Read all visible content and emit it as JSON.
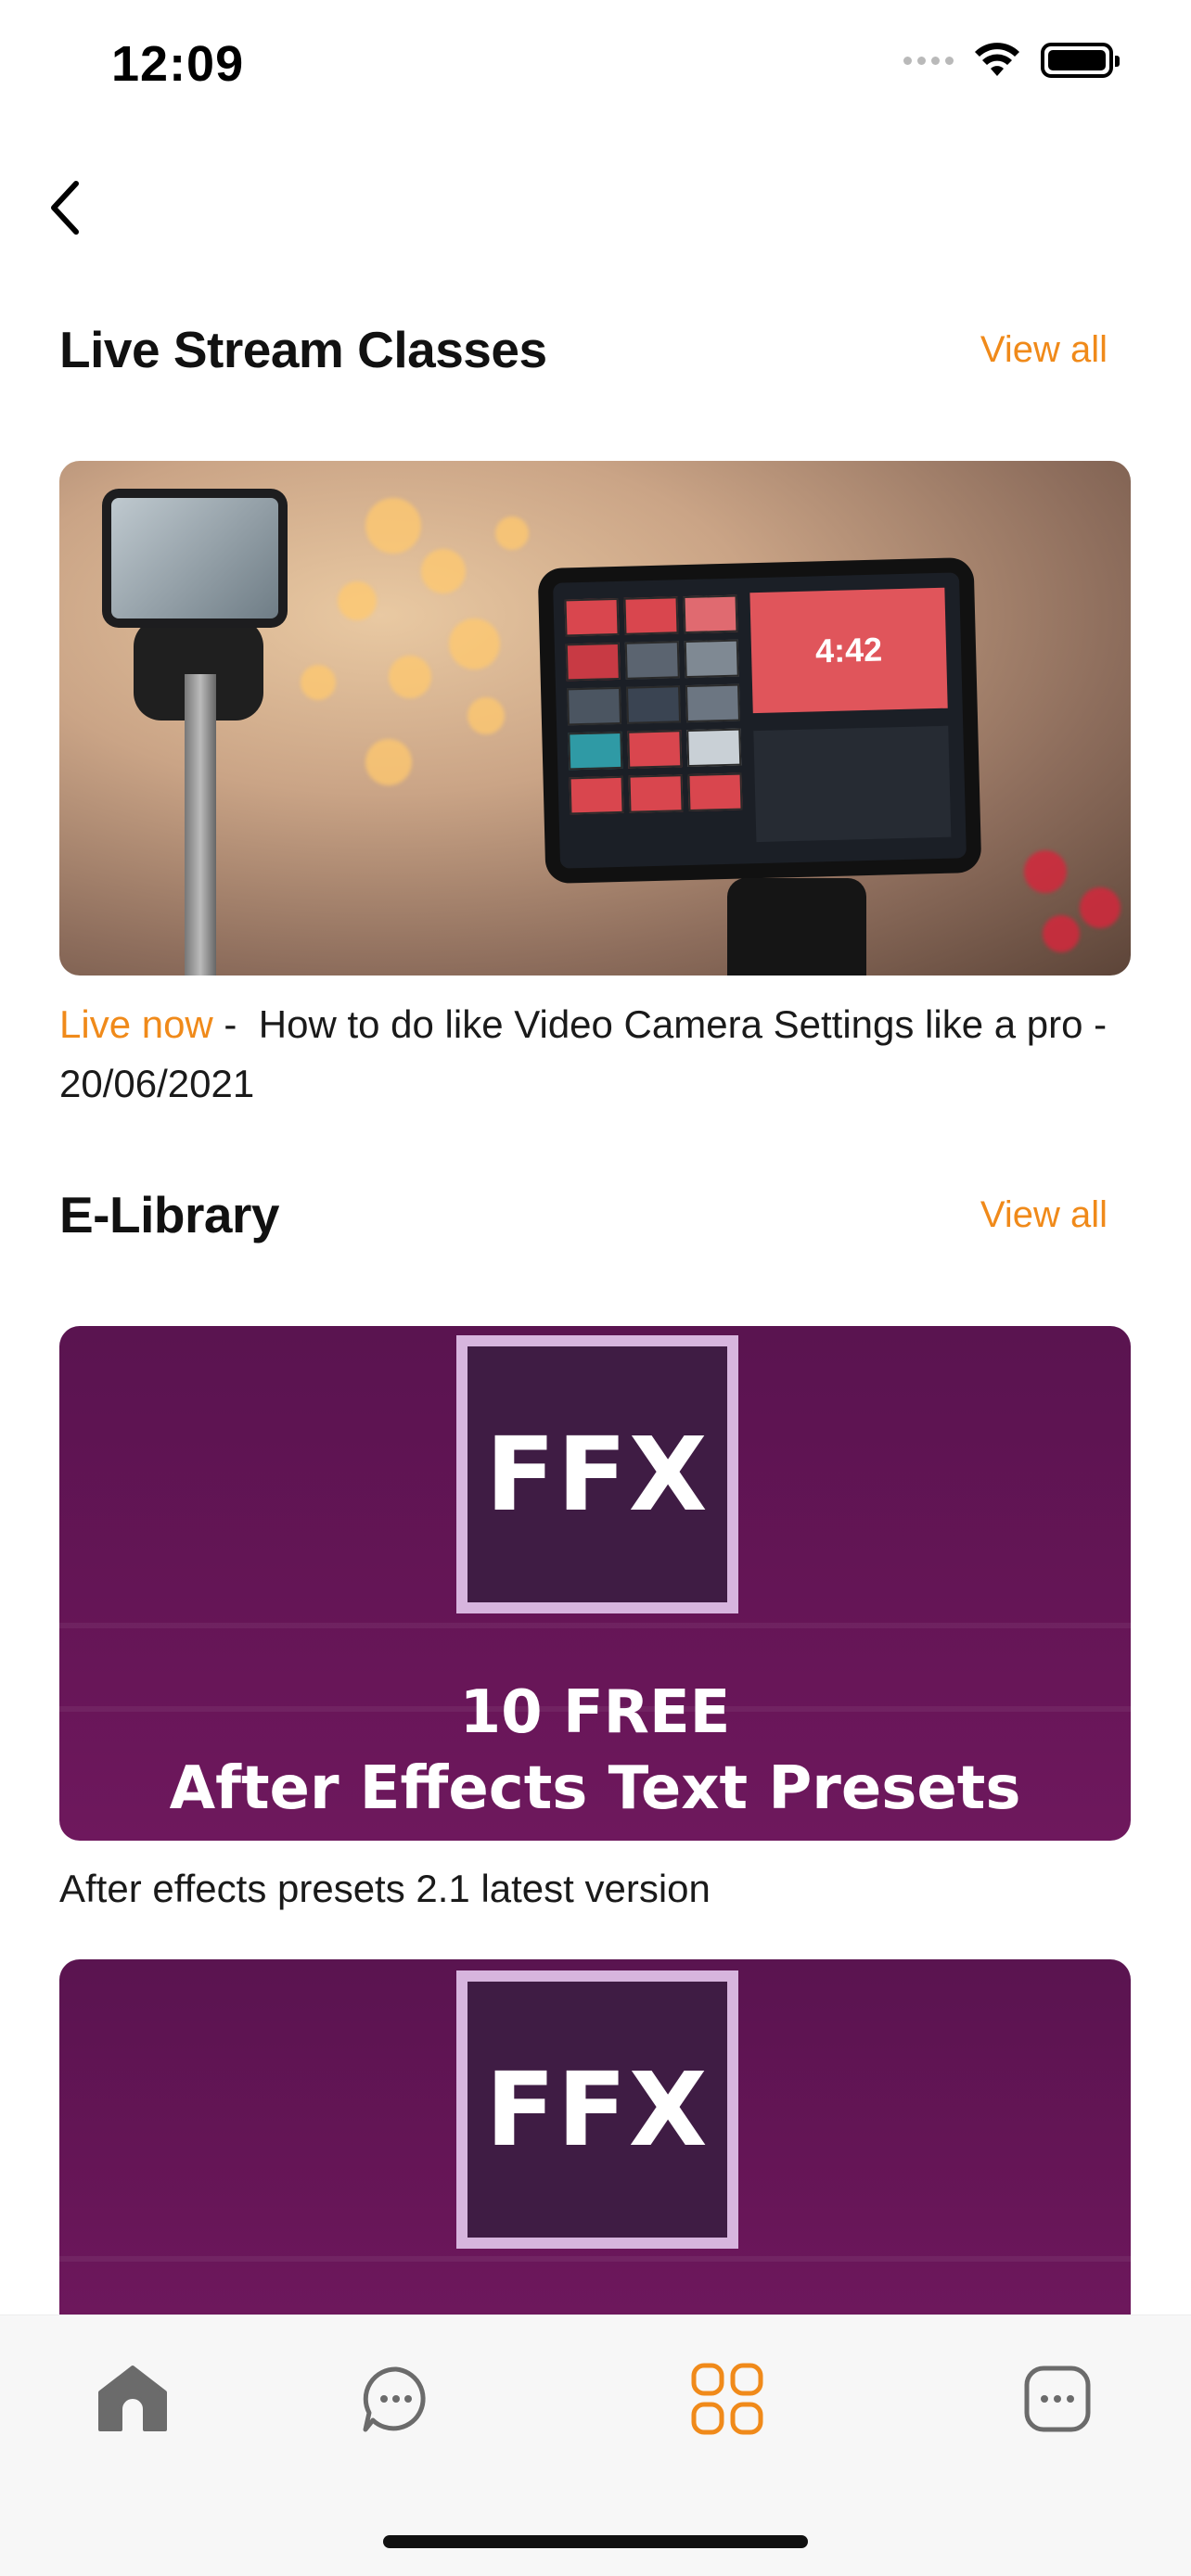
{
  "status_bar": {
    "time": "12:09"
  },
  "sections": {
    "live": {
      "title": "Live Stream Classes",
      "view_all": "View all",
      "item": {
        "live_label": "Live now",
        "separator": " - ",
        "text": "How to do like Video Camera Settings like a pro - 20/06/2021",
        "screen_time": "4:42"
      }
    },
    "library": {
      "title": "E-Library",
      "view_all": "View all",
      "items": [
        {
          "badge": "FFX",
          "line1": "10 FREE",
          "line2": "After Effects Text Presets",
          "caption": "After effects presets 2.1 latest version"
        },
        {
          "badge": "FFX"
        }
      ]
    }
  },
  "tabs": [
    {
      "name": "home-icon",
      "active": false
    },
    {
      "name": "chat-icon",
      "active": false
    },
    {
      "name": "grid-icon",
      "active": true
    },
    {
      "name": "more-icon",
      "active": false
    }
  ],
  "colors": {
    "accent": "#f08a1a",
    "inactive_icon": "#6b6b6b",
    "promo": "#651556"
  }
}
